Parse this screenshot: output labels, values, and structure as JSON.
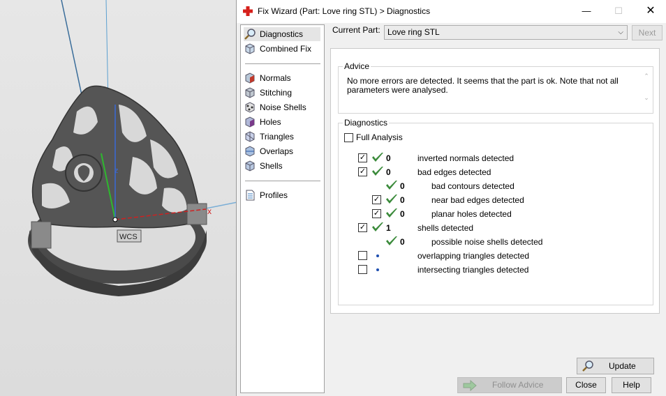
{
  "viewport": {
    "axis_x_label": "x",
    "axis_z_label": "z",
    "wcs_label": "WCS"
  },
  "window": {
    "title": "Fix Wizard (Part: Love ring STL) > Diagnostics",
    "minimize_glyph": "—",
    "maximize_glyph": "☐",
    "close_glyph": "✕"
  },
  "nav": {
    "items": [
      {
        "label": "Diagnostics",
        "icon": "magnifier-icon",
        "selected": true
      },
      {
        "label": "Combined Fix",
        "icon": "cube-icon"
      },
      {
        "label": "Normals",
        "icon": "normals-cube-icon"
      },
      {
        "label": "Stitching",
        "icon": "stitching-cube-icon"
      },
      {
        "label": "Noise Shells",
        "icon": "noise-shells-icon"
      },
      {
        "label": "Holes",
        "icon": "holes-cube-icon"
      },
      {
        "label": "Triangles",
        "icon": "triangles-icon"
      },
      {
        "label": "Overlaps",
        "icon": "overlaps-icon"
      },
      {
        "label": "Shells",
        "icon": "shells-icon"
      },
      {
        "label": "Profiles",
        "icon": "document-icon"
      }
    ]
  },
  "current_part": {
    "label": "Current Part:",
    "value": "Love ring STL"
  },
  "next_label": "Next",
  "advice": {
    "title": "Advice",
    "text": "No more errors are detected. It seems that the part is ok. Note that not all parameters were analysed."
  },
  "diagnostics": {
    "title": "Diagnostics",
    "full_analysis": "Full Analysis",
    "rows": [
      {
        "checked": true,
        "status": "ok",
        "count": "0",
        "label": "inverted normals detected",
        "indent": 0
      },
      {
        "checked": true,
        "status": "ok",
        "count": "0",
        "label": "bad edges detected",
        "indent": 0
      },
      {
        "checked": null,
        "status": "ok",
        "count": "0",
        "label": "bad contours detected",
        "indent": 1
      },
      {
        "checked": true,
        "status": "ok",
        "count": "0",
        "label": "near bad edges detected",
        "indent": 1
      },
      {
        "checked": true,
        "status": "ok",
        "count": "0",
        "label": "planar holes detected",
        "indent": 1
      },
      {
        "checked": true,
        "status": "ok",
        "count": "1",
        "label": "shells detected",
        "indent": 0
      },
      {
        "checked": null,
        "status": "ok",
        "count": "0",
        "label": "possible noise shells detected",
        "indent": 1
      },
      {
        "checked": false,
        "status": "pending",
        "count": "",
        "label": "overlapping triangles detected",
        "indent": 0
      },
      {
        "checked": false,
        "status": "pending",
        "count": "",
        "label": "intersecting triangles detected",
        "indent": 0
      }
    ],
    "update": "Update"
  },
  "bottom": {
    "follow_advice": "Follow Advice",
    "close": "Close",
    "help": "Help"
  },
  "colors": {
    "check_green": "#3a8a3a",
    "pending_dot": "#1f4fb0",
    "title_icon_red": "#d6201b"
  }
}
